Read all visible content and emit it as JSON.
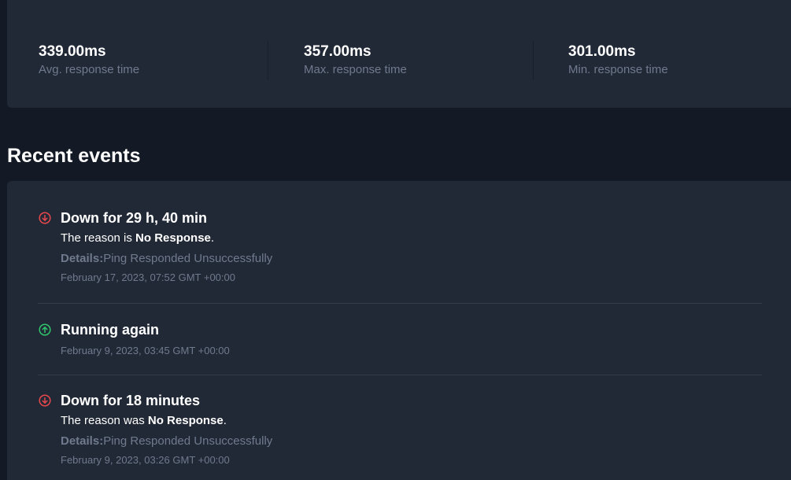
{
  "stats": [
    {
      "value": "339.00ms",
      "label": "Avg. response time"
    },
    {
      "value": "357.00ms",
      "label": "Max. response time"
    },
    {
      "value": "301.00ms",
      "label": "Min. response time"
    }
  ],
  "section_title": "Recent events",
  "events": [
    {
      "status": "down",
      "icon": "arrow-down-circle-icon",
      "title": "Down for 29 h, 40 min",
      "reason_prefix": "The reason is ",
      "reason": "No Response",
      "reason_suffix": ".",
      "details_label": "Details:",
      "details": "Ping Responded Unsuccessfully",
      "time": "February 17, 2023, 07:52 GMT +00:00"
    },
    {
      "status": "up",
      "icon": "arrow-up-circle-icon",
      "title": "Running again",
      "time": "February 9, 2023, 03:45 GMT +00:00"
    },
    {
      "status": "down",
      "icon": "arrow-down-circle-icon",
      "title": "Down for 18 minutes",
      "reason_prefix": "The reason was ",
      "reason": "No Response",
      "reason_suffix": ".",
      "details_label": "Details:",
      "details": "Ping Responded Unsuccessfully",
      "time": "February 9, 2023, 03:26 GMT +00:00"
    }
  ],
  "colors": {
    "down": "#e5484d",
    "up": "#30c46c"
  }
}
